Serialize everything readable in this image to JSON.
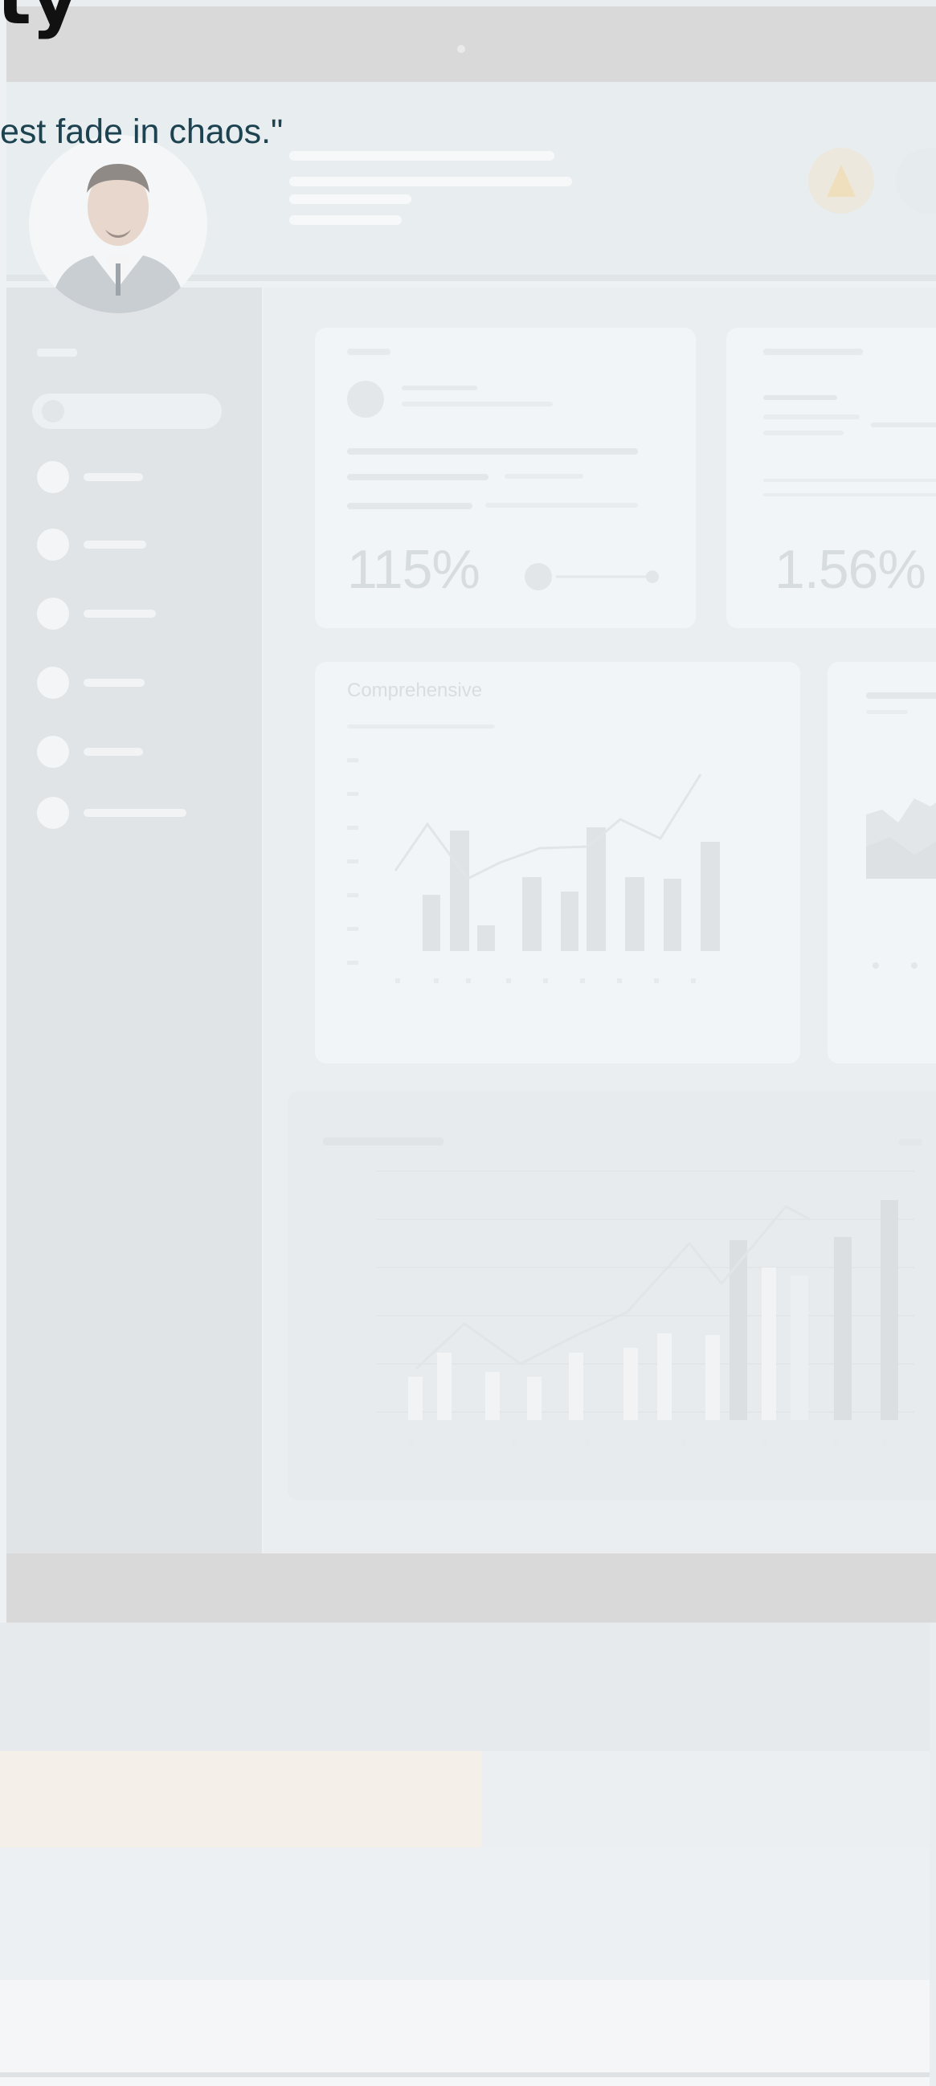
{
  "overlay": {
    "title_fragment": "ty",
    "quote_fragment": "est fade in chaos.\""
  },
  "dashboard": {
    "card1": {
      "value": "115%"
    },
    "card2": {
      "value": "1.56%"
    },
    "chart_card": {
      "title": "Comprehensive"
    }
  },
  "colors": {
    "quote_text": "#1d4250",
    "title_text": "#111111",
    "monitor_bezel": "#d9d9da",
    "screen_bg": "#edf1f3"
  }
}
